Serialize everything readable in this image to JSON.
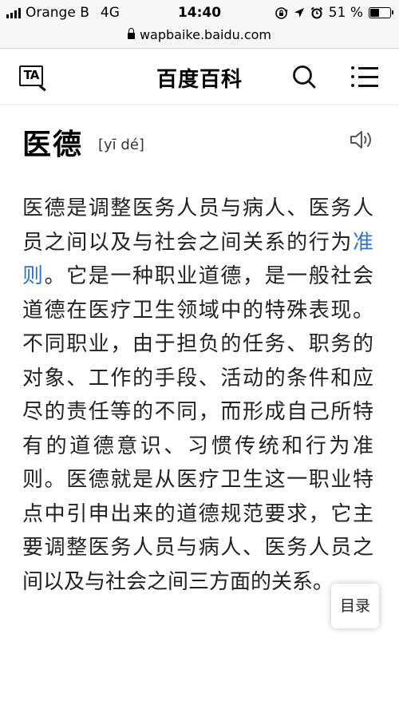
{
  "status_bar": {
    "carrier": "Orange B",
    "network": "4G",
    "time": "14:40",
    "battery": "51 %",
    "battery_level": 0.51,
    "icons": [
      "signal-icon",
      "screen-lock-icon",
      "location-icon",
      "alarm-icon",
      "battery-icon"
    ]
  },
  "url_bar": {
    "url": "wapbaike.baidu.com"
  },
  "header": {
    "font_button_label": "TA",
    "brand": "百度百科",
    "icons": [
      "font-size-icon",
      "search-icon",
      "menu-icon"
    ]
  },
  "entry": {
    "title": "医德",
    "pinyin": "[yī dé]",
    "body_before_link": "医德是调整医务人员与病人、医务人员之间以及与社会之间关系的行为",
    "link_text": "准则",
    "body_after_link": "。它是一种职业道德，是一般社会道德在医疗卫生领域中的特殊表现。不同职业，由于担负的任务、职务的对象、工作的手段、活动的条件和应尽的责任等的不同，而形成自己所特有的道德意识、习惯传统和行为准则。医德就是从医疗卫生这一职业特点中引申出来的道德规范要求，它主要调整医务人员与病人、医务人员之间以及与社会之间三方面的关系。"
  },
  "toc_button": {
    "label": "目录"
  },
  "colors": {
    "link": "#2e74c7",
    "status_bar_bg": "#f7f7f7",
    "text": "#222222"
  }
}
